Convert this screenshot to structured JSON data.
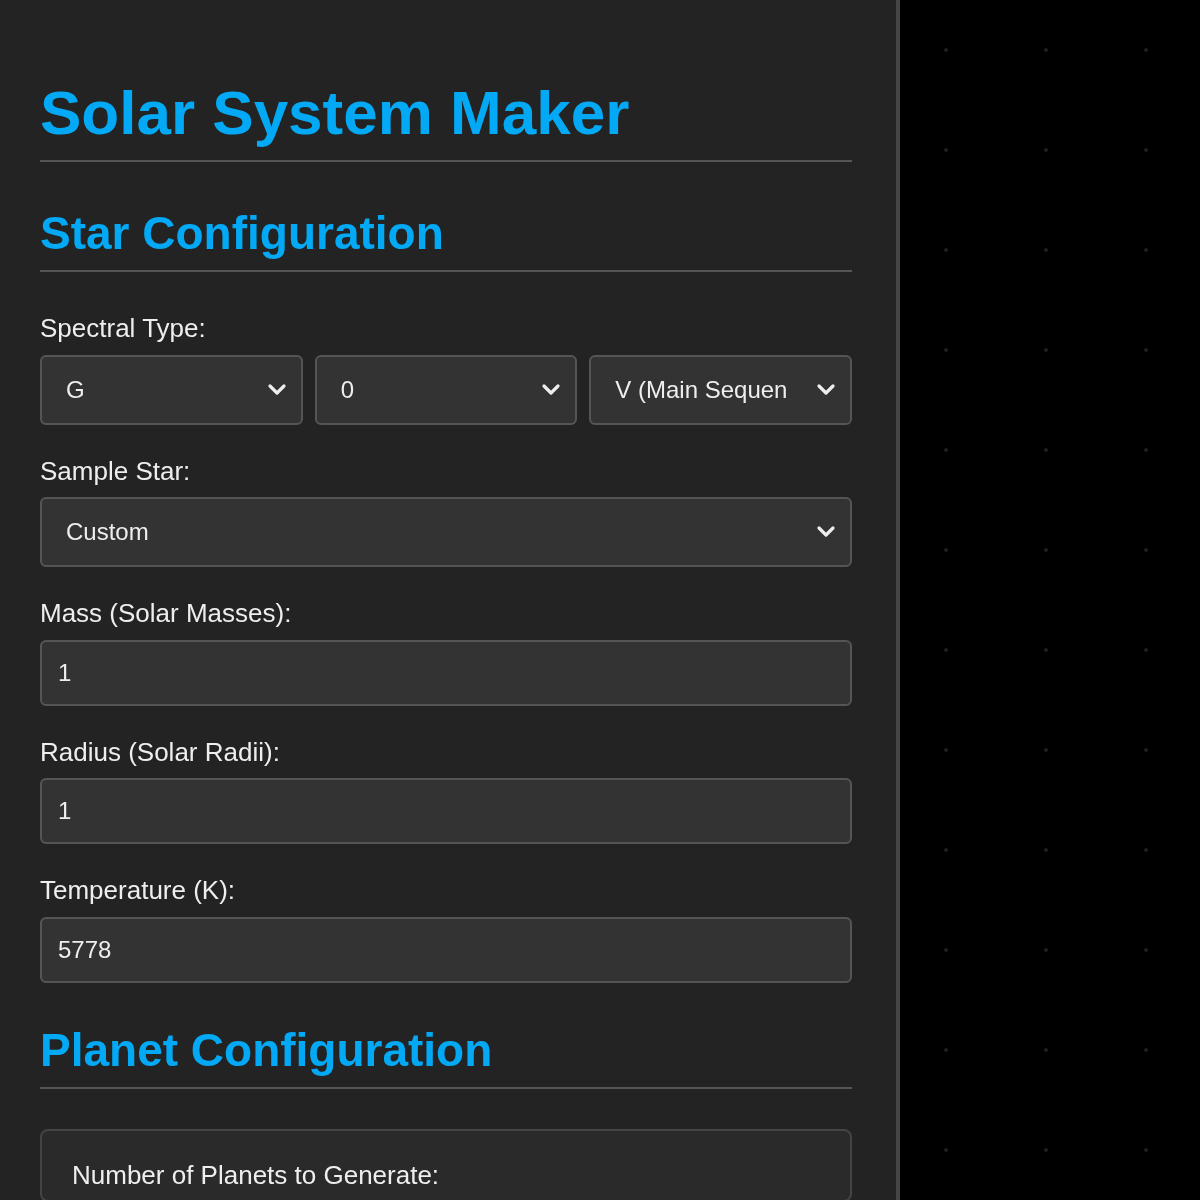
{
  "title": "Solar System Maker",
  "star_section": {
    "heading": "Star Configuration",
    "spectral_type": {
      "label": "Spectral Type:",
      "selects": [
        {
          "value": "G"
        },
        {
          "value": "0"
        },
        {
          "value": "V (Main Sequen"
        }
      ]
    },
    "sample_star": {
      "label": "Sample Star:",
      "value": "Custom"
    },
    "fields": [
      {
        "label": "Mass (Solar Masses):",
        "value": "1"
      },
      {
        "label": "Radius (Solar Radii):",
        "value": "1"
      },
      {
        "label": "Temperature (K):",
        "value": "5778"
      }
    ]
  },
  "planet_section": {
    "heading": "Planet Configuration",
    "card": {
      "label": "Number of Planets to Generate:"
    }
  }
}
